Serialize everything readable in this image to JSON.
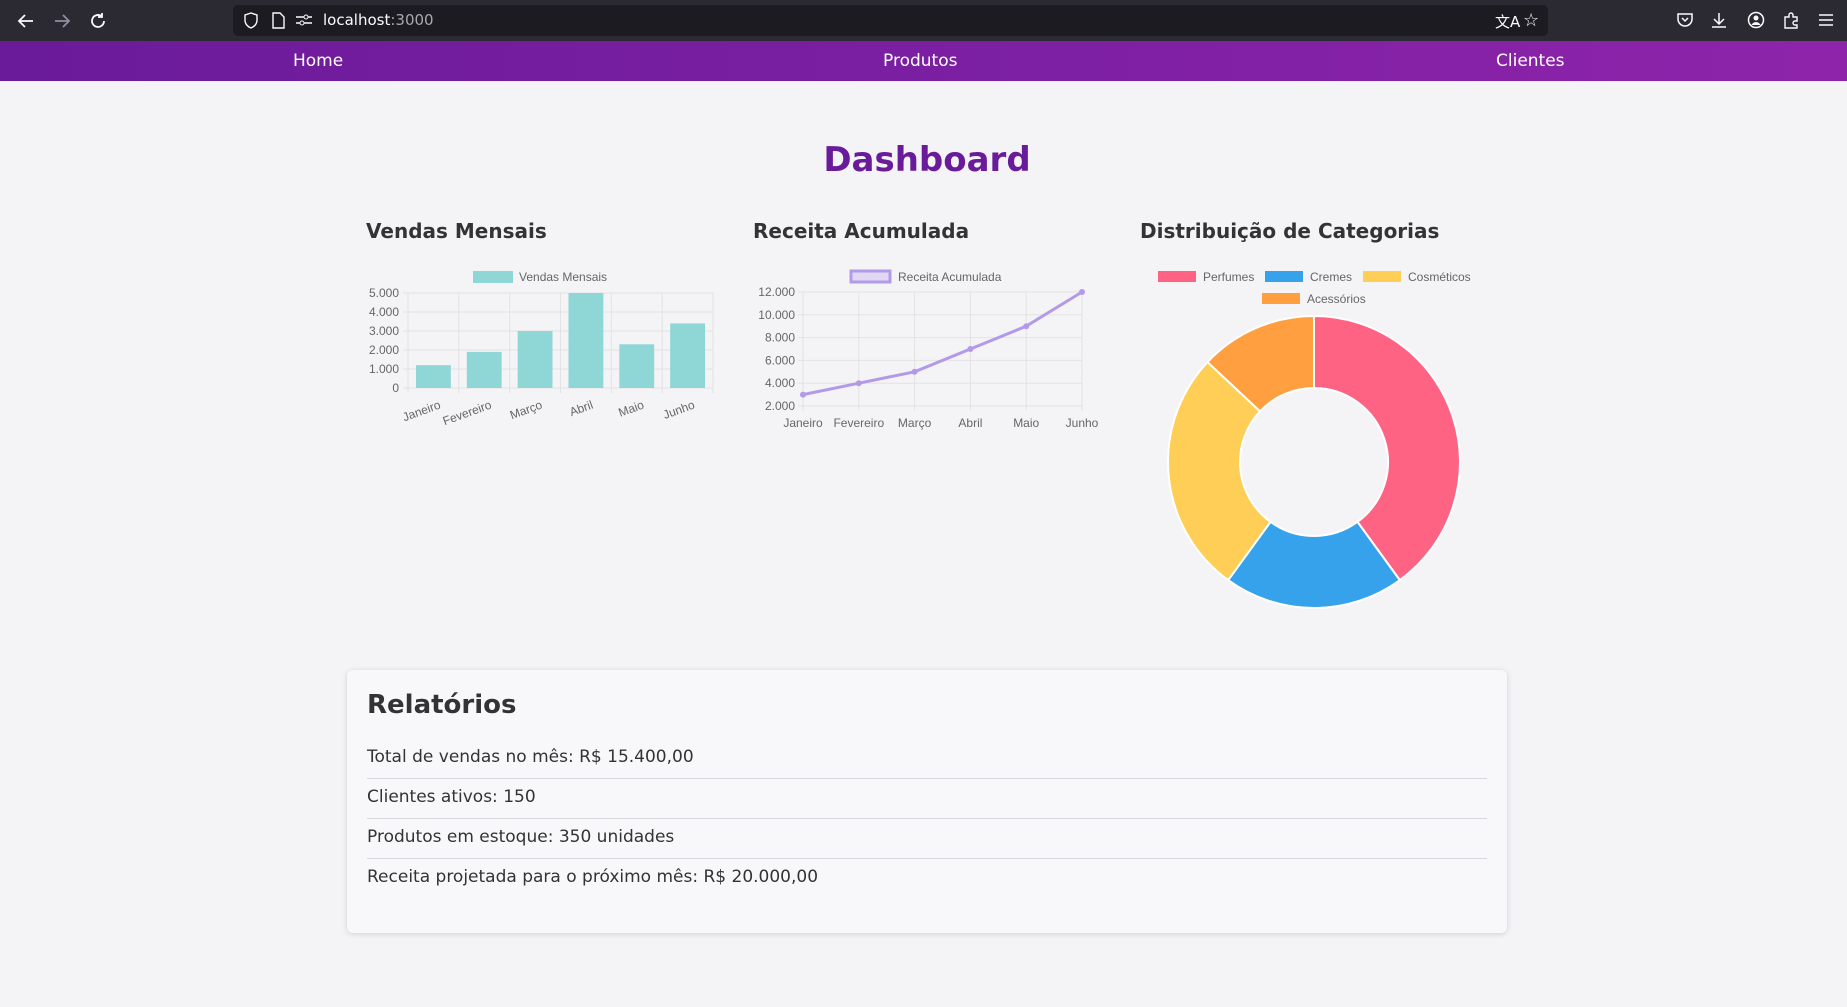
{
  "browser": {
    "url_host": "localhost",
    "url_port": ":3000"
  },
  "nav": {
    "items": [
      "Home",
      "Produtos",
      "Clientes"
    ]
  },
  "page": {
    "title": "Dashboard"
  },
  "charts_titles": {
    "sales": "Vendas Mensais",
    "revenue": "Receita Acumulada",
    "categories": "Distribuição de Categorias"
  },
  "chart_data": [
    {
      "type": "bar",
      "title": "Vendas Mensais",
      "legend": "Vendas Mensais",
      "categories": [
        "Janeiro",
        "Fevereiro",
        "Março",
        "Abril",
        "Maio",
        "Junho"
      ],
      "values": [
        1200,
        1900,
        3000,
        5000,
        2300,
        3400
      ],
      "yticks": [
        "0",
        "1.000",
        "2.000",
        "3.000",
        "4.000",
        "5.000"
      ],
      "ylim": [
        0,
        5000
      ],
      "color": "#8fd6d6",
      "grid": true,
      "legend_position": "top"
    },
    {
      "type": "line",
      "title": "Receita Acumulada",
      "legend": "Receita Acumulada",
      "categories": [
        "Janeiro",
        "Fevereiro",
        "Março",
        "Abril",
        "Maio",
        "Junho"
      ],
      "values": [
        3000,
        4000,
        5000,
        7000,
        9000,
        12000
      ],
      "yticks": [
        "2.000",
        "4.000",
        "6.000",
        "8.000",
        "10.000",
        "12.000"
      ],
      "ylim": [
        2000,
        12000
      ],
      "color": "#b39ae8",
      "grid": true,
      "legend_position": "top"
    },
    {
      "type": "pie",
      "title": "Distribuição de Categorias",
      "labels": [
        "Perfumes",
        "Cremes",
        "Cosméticos",
        "Acessórios"
      ],
      "values": [
        40,
        20,
        27,
        13
      ],
      "colors": [
        "#ff6384",
        "#36a2eb",
        "#ffce56",
        "#ff9f40"
      ],
      "legend_position": "top"
    }
  ],
  "reports": {
    "title": "Relatórios",
    "items": [
      "Total de vendas no mês: R$ 15.400,00",
      "Clientes ativos: 150",
      "Produtos em estoque: 350 unidades",
      "Receita projetada para o próximo mês: R$ 20.000,00"
    ]
  }
}
